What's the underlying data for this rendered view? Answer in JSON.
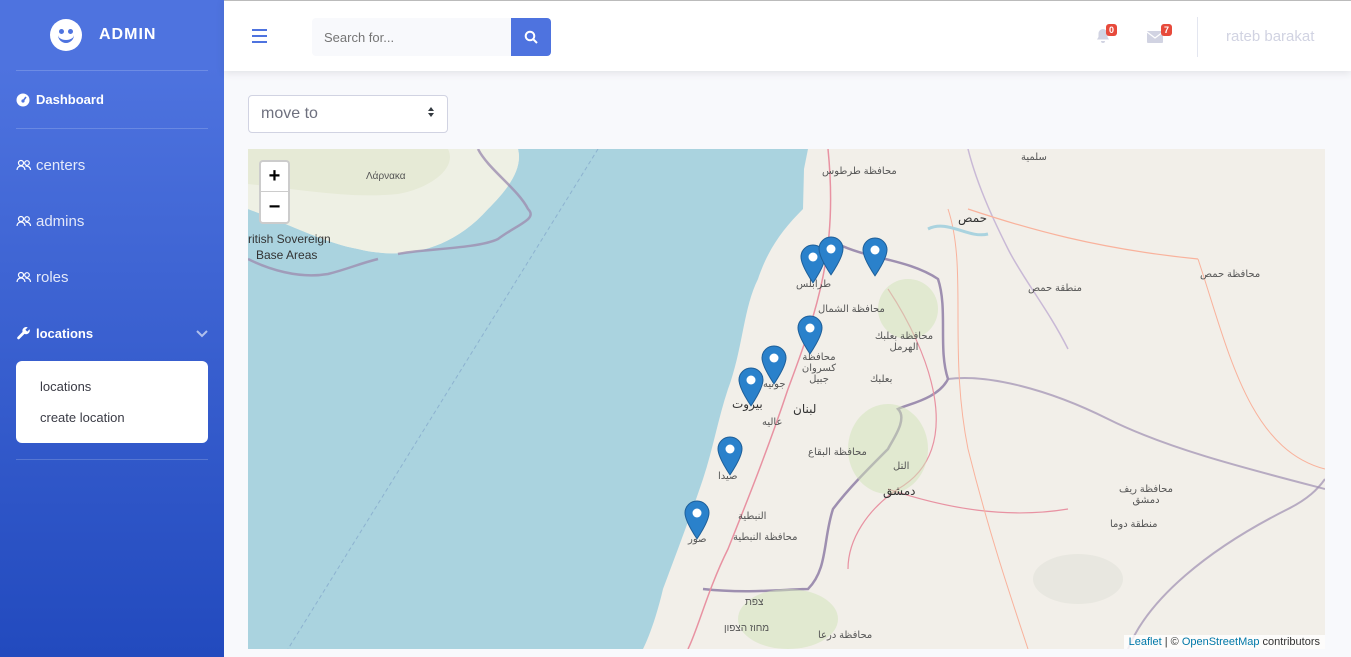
{
  "sidebar": {
    "brand": "ADMIN",
    "dashboard": "Dashboard",
    "items": [
      {
        "label": "centers"
      },
      {
        "label": "admins"
      },
      {
        "label": "roles"
      }
    ],
    "locations": {
      "label": "locations",
      "sub": [
        "locations",
        "create location"
      ]
    }
  },
  "topbar": {
    "search_placeholder": "Search for...",
    "alerts_count": "0",
    "messages_count": "7",
    "user": "rateb barakat"
  },
  "content": {
    "select_value": "move to"
  },
  "map": {
    "zoom_in": "+",
    "zoom_out": "−",
    "attr_leaflet": "Leaflet",
    "attr_sep": " | © ",
    "attr_osm": "OpenStreetMap",
    "attr_tail": " contributors",
    "labels": {
      "larnaka": "Λάρνακα",
      "sovereign1": "ritish Sovereign",
      "sovereign2": "Base Areas",
      "tartus": "محافظة طرطوس",
      "homs": "حمص",
      "homs_gov": "محافظة حمص",
      "homs_region": "منطقة حمص",
      "salamiyah": "سلمية",
      "tripoli": "طرابلس",
      "north_gov": "محافظة الشمال",
      "baalbek_gov": "محافظة بعلبك الهرمل",
      "keserwan": "محافظة كسروان جبيل",
      "baalbek": "بعلبك",
      "jounieh": "جونيه",
      "beirut": "بيروت",
      "lebanon": "لبنان",
      "aley": "عاليه",
      "bekaa": "محافظة البقاع",
      "sidon": "صيدا",
      "damascus": "دمشق",
      "tal": "التل",
      "rif_dimashq": "محافظة ريف دمشق",
      "douma": "منطقة دوما",
      "nabatieh": "النبطية",
      "nabatieh_gov": "محافظة النبطية",
      "tyre": "صور",
      "safed": "צפת",
      "north_dist": "מחוז הצפון",
      "daraa": "محافظة درعا"
    }
  },
  "colors": {
    "primary": "#4e73df",
    "sea": "#aad3df",
    "land": "#f2efe9",
    "marker": "#2a81cb",
    "badge": "#e74a3b"
  }
}
